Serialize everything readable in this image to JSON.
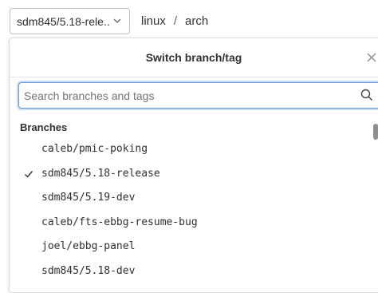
{
  "branch_button": {
    "label": "sdm845/5.18-rele..."
  },
  "breadcrumb": {
    "items": [
      "linux",
      "arch"
    ],
    "separator": "/"
  },
  "dropdown": {
    "title": "Switch branch/tag",
    "search": {
      "placeholder": "Search branches and tags",
      "value": ""
    },
    "section_title": "Branches",
    "items": [
      {
        "label": "caleb/pmic-poking",
        "selected": false
      },
      {
        "label": "sdm845/5.18-release",
        "selected": true
      },
      {
        "label": "sdm845/5.19-dev",
        "selected": false
      },
      {
        "label": "caleb/fts-ebbg-resume-bug",
        "selected": false
      },
      {
        "label": "joel/ebbg-panel",
        "selected": false
      },
      {
        "label": "sdm845/5.18-dev",
        "selected": false
      }
    ]
  },
  "icons": {
    "dropdown_chevron": "chevron-down-icon",
    "close": "close-icon",
    "search": "search-icon",
    "selected": "check-icon"
  },
  "colors": {
    "focus_border": "#6a9bd8",
    "text": "#303030",
    "border": "#bfbfbf"
  }
}
